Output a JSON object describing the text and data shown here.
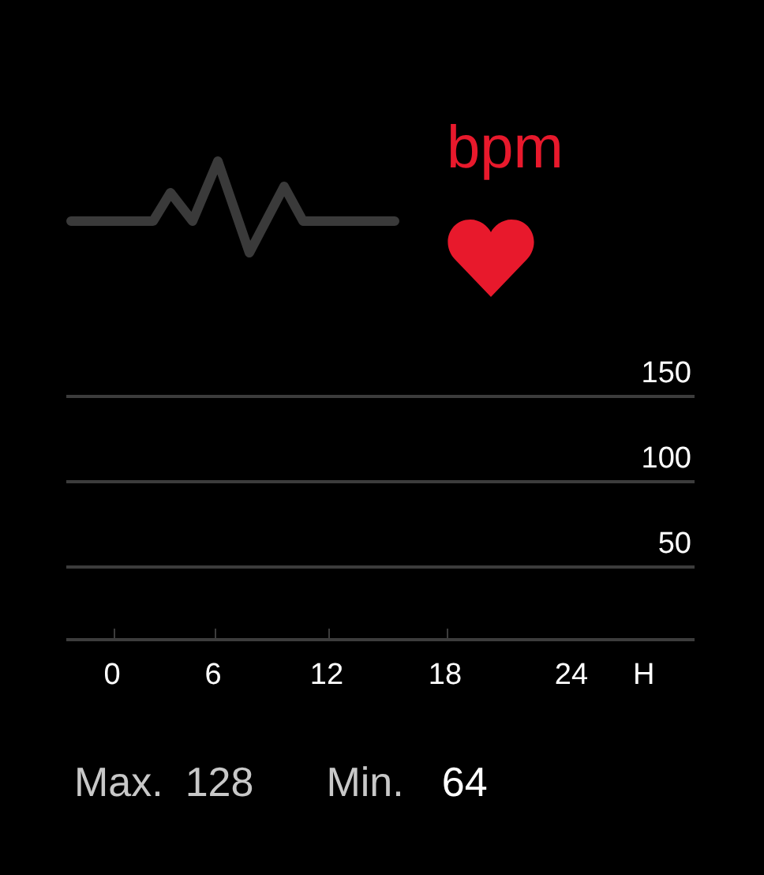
{
  "header": {
    "unit": "bpm"
  },
  "chart": {
    "y_labels": [
      "150",
      "100",
      "50"
    ],
    "x_labels": [
      "0",
      "6",
      "12",
      "18",
      "24"
    ],
    "x_unit": "H"
  },
  "stats": [
    {
      "label": "Max.",
      "value": "128",
      "kind": "max"
    },
    {
      "label": "Min.",
      "value": "64",
      "kind": "min"
    }
  ]
}
